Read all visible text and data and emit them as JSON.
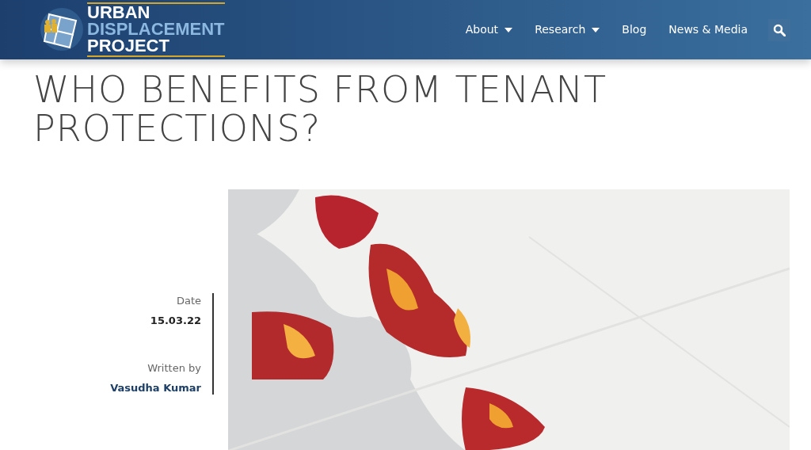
{
  "header": {
    "logo_lines": [
      "URBAN",
      "DISPLACEMENT",
      "PROJECT"
    ],
    "nav": [
      {
        "label": "About",
        "dropdown": true
      },
      {
        "label": "Research",
        "dropdown": true
      },
      {
        "label": "Blog",
        "dropdown": false
      },
      {
        "label": "News & Media",
        "dropdown": false
      }
    ]
  },
  "article": {
    "title": "WHO BENEFITS FROM TENANT PROTECTIONS?",
    "meta": [
      {
        "label": "Date",
        "value": "15.03.22",
        "kind": "text"
      },
      {
        "label": "Written by",
        "value": "Vasudha Kumar",
        "kind": "author"
      }
    ]
  }
}
